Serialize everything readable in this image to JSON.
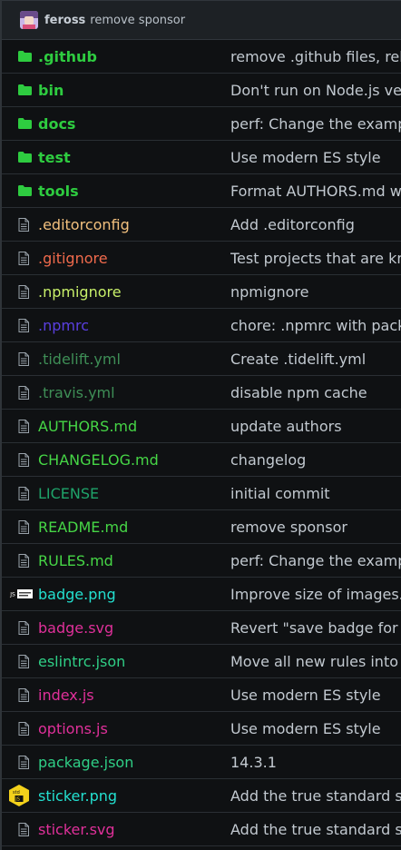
{
  "commit": {
    "author": "feross",
    "message": "remove sponsor"
  },
  "colors": {
    "background": "#0f1113",
    "folder": "#2ecc40",
    "file_icon": "#9aa3ab"
  },
  "rows": [
    {
      "name": ".github",
      "message": "remove .github files, rely",
      "type": "dir",
      "icon": "folder-icon",
      "color": "#2ecc40"
    },
    {
      "name": "bin",
      "message": "Don't run on Node.js vers",
      "type": "dir",
      "icon": "folder-icon",
      "color": "#2ecc40"
    },
    {
      "name": "docs",
      "message": "perf: Change the example",
      "type": "dir",
      "icon": "folder-icon",
      "color": "#2ecc40"
    },
    {
      "name": "test",
      "message": "Use modern ES style",
      "type": "dir",
      "icon": "folder-icon",
      "color": "#2ecc40"
    },
    {
      "name": "tools",
      "message": "Format AUTHORS.md wit",
      "type": "dir",
      "icon": "folder-icon",
      "color": "#2ecc40"
    },
    {
      "name": ".editorconfig",
      "message": "Add .editorconfig",
      "type": "file",
      "icon": "file-icon",
      "color": "#f2c07e"
    },
    {
      "name": ".gitignore",
      "message": "Test projects that are kno",
      "type": "file",
      "icon": "file-icon",
      "color": "#f06a4c"
    },
    {
      "name": ".npmignore",
      "message": "npmignore",
      "type": "file",
      "icon": "file-icon",
      "color": "#c8f06a"
    },
    {
      "name": ".npmrc",
      "message": "chore: .npmrc with packa",
      "type": "file",
      "icon": "file-icon",
      "color": "#5a3fe0"
    },
    {
      "name": ".tidelift.yml",
      "message": "Create .tidelift.yml",
      "type": "file",
      "icon": "file-icon",
      "color": "#3e8e56"
    },
    {
      "name": ".travis.yml",
      "message": "disable npm cache",
      "type": "file",
      "icon": "file-icon",
      "color": "#3e8e56"
    },
    {
      "name": "AUTHORS.md",
      "message": "update authors",
      "type": "file",
      "icon": "file-icon",
      "color": "#46d646"
    },
    {
      "name": "CHANGELOG.md",
      "message": "changelog",
      "type": "file",
      "icon": "file-icon",
      "color": "#46d646"
    },
    {
      "name": "LICENSE",
      "message": "initial commit",
      "type": "file",
      "icon": "file-icon",
      "color": "#1fa36a"
    },
    {
      "name": "README.md",
      "message": "remove sponsor",
      "type": "file",
      "icon": "file-icon",
      "color": "#46d646"
    },
    {
      "name": "RULES.md",
      "message": "perf: Change the example",
      "type": "file",
      "icon": "file-icon",
      "color": "#46d646"
    },
    {
      "name": "badge.png",
      "message": "Improve size of images.",
      "type": "file",
      "icon": "badge-thumbnail-icon",
      "color": "#23e0d0"
    },
    {
      "name": "badge.svg",
      "message": "Revert \"save badge for w",
      "type": "file",
      "icon": "file-icon",
      "color": "#e0309a"
    },
    {
      "name": "eslintrc.json",
      "message": "Move all new rules into sl",
      "type": "file",
      "icon": "file-icon",
      "color": "#2fcf86"
    },
    {
      "name": "index.js",
      "message": "Use modern ES style",
      "type": "file",
      "icon": "file-icon",
      "color": "#e0309a"
    },
    {
      "name": "options.js",
      "message": "Use modern ES style",
      "type": "file",
      "icon": "file-icon",
      "color": "#e0309a"
    },
    {
      "name": "package.json",
      "message": "14.3.1",
      "type": "file",
      "icon": "file-icon",
      "color": "#2fcf86"
    },
    {
      "name": "sticker.png",
      "message": "Add the true standard sti",
      "type": "file",
      "icon": "sticker-thumbnail-icon",
      "color": "#23e0d0"
    },
    {
      "name": "sticker.svg",
      "message": "Add the true standard sti",
      "type": "file",
      "icon": "file-icon",
      "color": "#e0309a"
    }
  ]
}
